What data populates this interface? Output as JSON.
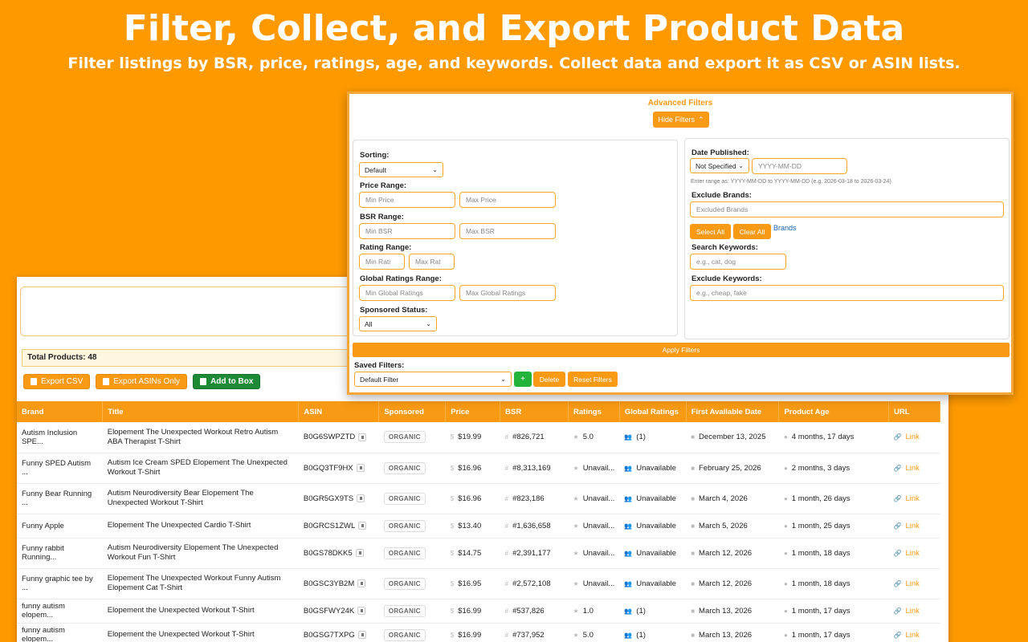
{
  "hero": {
    "title": "Filter, Collect, and Export Product Data",
    "subtitle": "Filter listings by BSR, price, ratings, age, and keywords. Collect data and export it as CSV or ASIN lists."
  },
  "summary": {
    "total_label": "Total Products: 48"
  },
  "actions": {
    "export_csv": "Export CSV",
    "export_asins": "Export ASINs Only",
    "add_to_box": "Add to Box"
  },
  "table": {
    "headers": [
      "Brand",
      "Title",
      "ASIN",
      "Sponsored",
      "Price",
      "BSR",
      "Ratings",
      "Global Ratings",
      "First Available Date",
      "Product Age",
      "URL"
    ],
    "rows": [
      {
        "brand": "Autism Inclusion SPE...",
        "title": "Elopement The Unexpected Workout Retro Autism ABA Therapist T-Shirt",
        "asin": "B0G6SWPZTD",
        "sponsored": "ORGANIC",
        "price": "$19.99",
        "bsr": "#826,721",
        "ratings": "5.0",
        "global": "(1)",
        "date": "December 13, 2025",
        "age": "4 months, 17 days",
        "url": "Link"
      },
      {
        "brand": "Funny SPED Autism ...",
        "title": "Autism Ice Cream SPED Elopement The Unexpected Workout T-Shirt",
        "asin": "B0GQ3TF9HX",
        "sponsored": "ORGANIC",
        "price": "$16.96",
        "bsr": "#8,313,169",
        "ratings": "Unavail...",
        "global": "Unavailable",
        "date": "February 25, 2026",
        "age": "2 months, 3 days",
        "url": "Link"
      },
      {
        "brand": "Funny Bear Running ...",
        "title": "Autism Neurodiversity Bear Elopement The Unexpected Workout T-Shirt",
        "asin": "B0GR5GX9TS",
        "sponsored": "ORGANIC",
        "price": "$16.96",
        "bsr": "#823,186",
        "ratings": "Unavail...",
        "global": "Unavailable",
        "date": "March 4, 2026",
        "age": "1 month, 26 days",
        "url": "Link"
      },
      {
        "brand": "Funny Apple",
        "title": "Elopement The Unexpected Cardio T-Shirt",
        "asin": "B0GRCS1ZWL",
        "sponsored": "ORGANIC",
        "price": "$13.40",
        "bsr": "#1,636,658",
        "ratings": "Unavail...",
        "global": "Unavailable",
        "date": "March 5, 2026",
        "age": "1 month, 25 days",
        "url": "Link"
      },
      {
        "brand": "Funny rabbit Running...",
        "title": "Autism Neurodiversity Elopement The Unexpected Workout Fun T-Shirt",
        "asin": "B0GS78DKK5",
        "sponsored": "ORGANIC",
        "price": "$14.75",
        "bsr": "#2,391,177",
        "ratings": "Unavail...",
        "global": "Unavailable",
        "date": "March 12, 2026",
        "age": "1 month, 18 days",
        "url": "Link"
      },
      {
        "brand": "Funny graphic tee by ...",
        "title": "Elopement The Unexpected Workout Funny Autism Elopement Cat T-Shirt",
        "asin": "B0GSC3YB2M",
        "sponsored": "ORGANIC",
        "price": "$16.95",
        "bsr": "#2,572,108",
        "ratings": "Unavail...",
        "global": "Unavailable",
        "date": "March 12, 2026",
        "age": "1 month, 18 days",
        "url": "Link"
      },
      {
        "brand": "funny autism elopem...",
        "title": "Elopement the Unexpected Workout T-Shirt",
        "asin": "B0GSFWY24K",
        "sponsored": "ORGANIC",
        "price": "$16.99",
        "bsr": "#537,826",
        "ratings": "1.0",
        "global": "(1)",
        "date": "March 13, 2026",
        "age": "1 month, 17 days",
        "url": "Link"
      },
      {
        "brand": "funny autism elopem...",
        "title": "Elopement the Unexpected Workout T-Shirt",
        "asin": "B0GSG7TXPG",
        "sponsored": "ORGANIC",
        "price": "$16.99",
        "bsr": "#737,952",
        "ratings": "5.0",
        "global": "(1)",
        "date": "March 13, 2026",
        "age": "1 month, 17 days",
        "url": "Link"
      }
    ]
  },
  "filters": {
    "title": "Advanced Filters",
    "hide_button": "Hide Filters",
    "sorting": {
      "label": "Sorting:",
      "value": "Default"
    },
    "price": {
      "label": "Price Range:",
      "min_placeholder": "Min Price",
      "max_placeholder": "Max Price"
    },
    "bsr": {
      "label": "BSR Range:",
      "min_placeholder": "Min BSR",
      "max_placeholder": "Max BSR"
    },
    "rating": {
      "label": "Rating Range:",
      "min_placeholder": "Min Rati",
      "max_placeholder": "Max Rat"
    },
    "global_ratings": {
      "label": "Global Ratings Range:",
      "min_placeholder": "Min Global Ratings",
      "max_placeholder": "Max Global Ratings"
    },
    "sponsored": {
      "label": "Sponsored Status:",
      "value": "All"
    },
    "date_published": {
      "label": "Date Published:",
      "mode": "Not Specified",
      "placeholder": "YYYY-MM-DD",
      "hint": "Enter range as: YYYY-MM-DD to YYYY-MM-DD  (e.g. 2026-03-18 to 2026-03-24)"
    },
    "exclude_brands": {
      "label": "Exclude Brands:",
      "placeholder": "Excluded Brands",
      "select_all": "Select All",
      "clear_all": "Clear All",
      "brands_link": "Brands"
    },
    "search_keywords": {
      "label": "Search Keywords:",
      "placeholder": "e.g., cat, dog"
    },
    "exclude_keywords": {
      "label": "Exclude Keywords:",
      "placeholder": "e.g., cheap, fake"
    },
    "apply": "Apply Filters",
    "saved": {
      "label": "Saved Filters:",
      "value": "Default Filter",
      "add": "+",
      "delete": "Delete",
      "reset": "Reset Filters"
    }
  },
  "colors": {
    "accent": "#fe9a00",
    "button": "#f89a14",
    "green": "#1e8a35",
    "link": "#1a62b3"
  }
}
